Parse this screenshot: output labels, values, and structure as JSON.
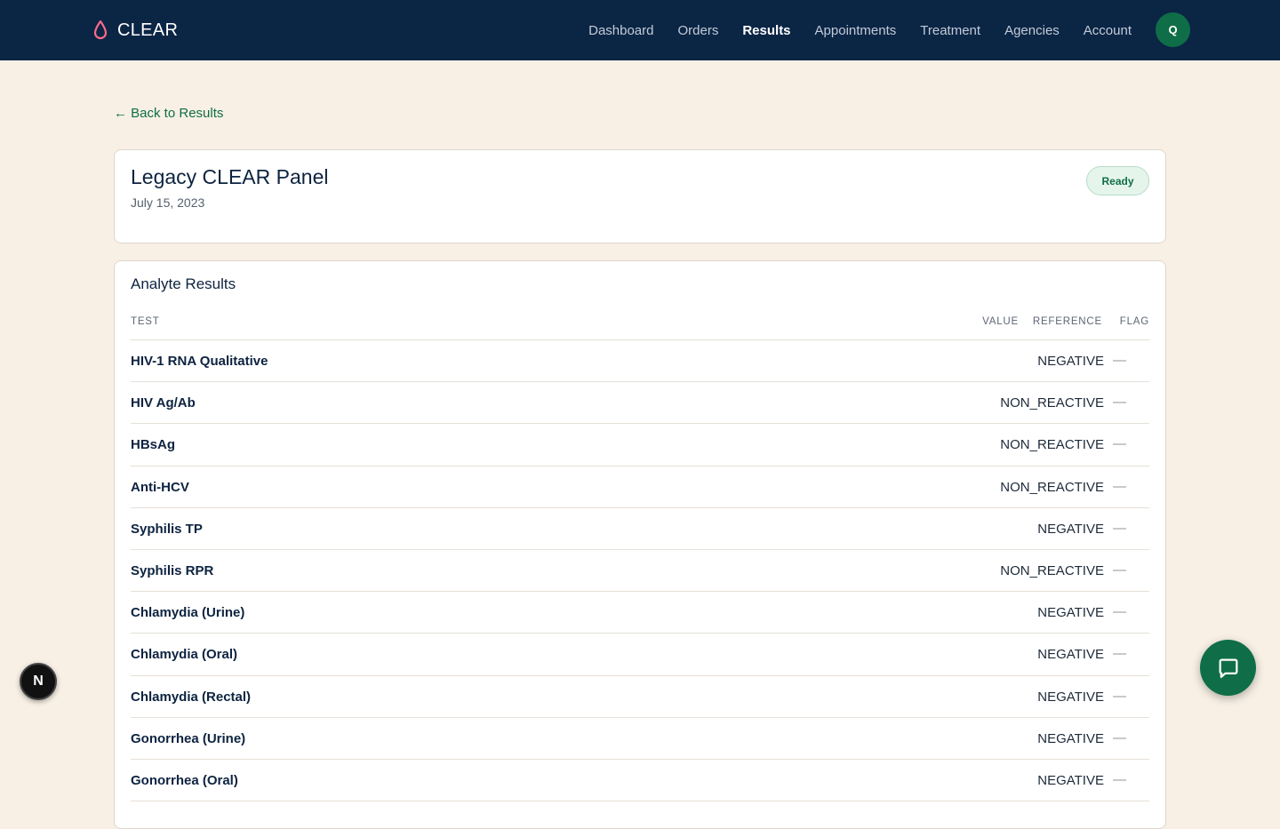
{
  "app": {
    "brand": "CLEAR",
    "avatar_initial": "Q"
  },
  "nav": {
    "items": [
      {
        "label": "Dashboard",
        "active": false
      },
      {
        "label": "Orders",
        "active": false
      },
      {
        "label": "Results",
        "active": true
      },
      {
        "label": "Appointments",
        "active": false
      },
      {
        "label": "Treatment",
        "active": false
      },
      {
        "label": "Agencies",
        "active": false
      },
      {
        "label": "Account",
        "active": false
      }
    ]
  },
  "back_link": "← Back to Results",
  "panel": {
    "title": "Legacy CLEAR Panel",
    "date": "July 15, 2023",
    "status": "Ready"
  },
  "results": {
    "section_title": "Analyte Results",
    "columns": {
      "test": "TEST",
      "value": "VALUE",
      "reference": "REFERENCE",
      "flag": "FLAG"
    },
    "rows": [
      {
        "test": "HIV-1 RNA Qualitative",
        "value": "",
        "reference": "NEGATIVE",
        "flag": "—"
      },
      {
        "test": "HIV Ag/Ab",
        "value": "",
        "reference": "NON_REACTIVE",
        "flag": "—"
      },
      {
        "test": "HBsAg",
        "value": "",
        "reference": "NON_REACTIVE",
        "flag": "—"
      },
      {
        "test": "Anti-HCV",
        "value": "",
        "reference": "NON_REACTIVE",
        "flag": "—"
      },
      {
        "test": "Syphilis TP",
        "value": "",
        "reference": "NEGATIVE",
        "flag": "—"
      },
      {
        "test": "Syphilis RPR",
        "value": "",
        "reference": "NON_REACTIVE",
        "flag": "—"
      },
      {
        "test": "Chlamydia (Urine)",
        "value": "",
        "reference": "NEGATIVE",
        "flag": "—"
      },
      {
        "test": "Chlamydia (Oral)",
        "value": "",
        "reference": "NEGATIVE",
        "flag": "—"
      },
      {
        "test": "Chlamydia (Rectal)",
        "value": "",
        "reference": "NEGATIVE",
        "flag": "—"
      },
      {
        "test": "Gonorrhea (Urine)",
        "value": "",
        "reference": "NEGATIVE",
        "flag": "—"
      },
      {
        "test": "Gonorrhea (Oral)",
        "value": "",
        "reference": "NEGATIVE",
        "flag": "—"
      }
    ]
  },
  "widgets": {
    "dev_badge": "N"
  },
  "colors": {
    "nav_bg": "#0b2545",
    "page_bg": "#f8f0e5",
    "accent_green": "#0f6e47",
    "brand_drop": "#ff6b8a"
  },
  "icons": {
    "brand": "droplet-icon",
    "chat": "chat-bubble-icon"
  }
}
